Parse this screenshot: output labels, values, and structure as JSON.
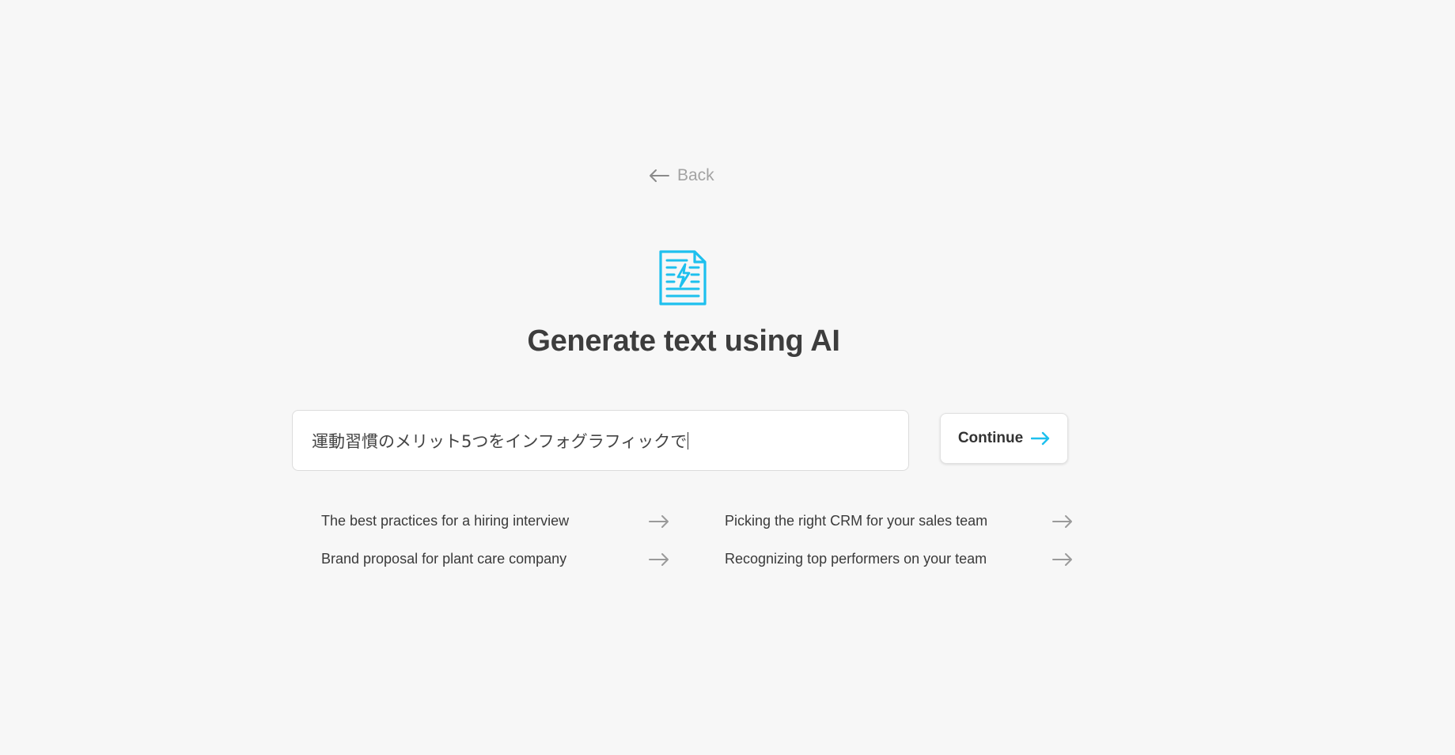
{
  "nav": {
    "back_label": "Back"
  },
  "hero": {
    "icon": "ai-document-bolt-icon",
    "title": "Generate text using AI"
  },
  "prompt": {
    "value": "運動習慣のメリット5つをインフォグラフィックで"
  },
  "actions": {
    "continue_label": "Continue"
  },
  "suggestions": [
    {
      "label": "The best practices for a hiring interview"
    },
    {
      "label": "Picking the right CRM for your sales team"
    },
    {
      "label": "Brand proposal for plant care company"
    },
    {
      "label": "Recognizing top performers on your team"
    }
  ],
  "colors": {
    "accent": "#1ec0ee",
    "background": "#f7f7f7",
    "muted": "#a3a3a3",
    "title": "#3d3d3d"
  }
}
